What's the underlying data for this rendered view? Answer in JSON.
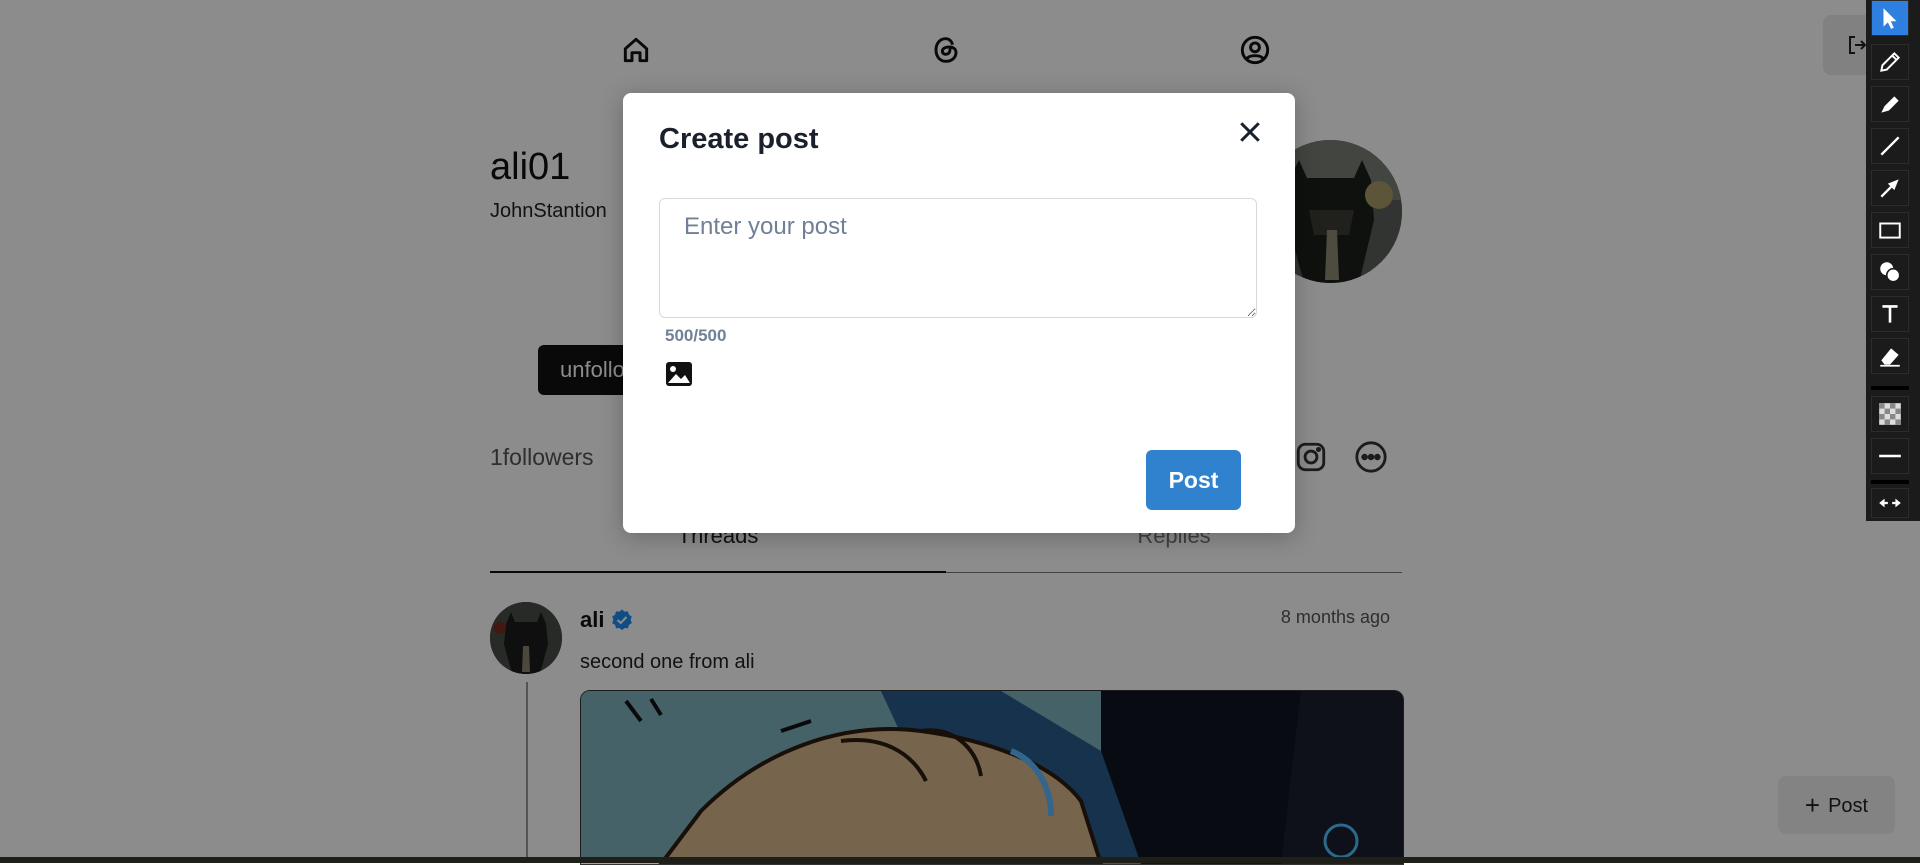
{
  "nav": {
    "icons": [
      "home-icon",
      "threads-logo-icon",
      "user-icon"
    ],
    "logout_icon": "logout-icon"
  },
  "profile": {
    "username": "ali01",
    "full_name": "JohnStantion",
    "unfollow_label": "unfollow",
    "followers": "1followers",
    "social_icons": [
      "instagram-icon",
      "more-icon"
    ]
  },
  "tabs": [
    {
      "label": "Threads",
      "active": true
    },
    {
      "label": "Replies",
      "active": false
    }
  ],
  "post": {
    "author": "ali",
    "verified_icon": "verified-icon",
    "time": "8 months ago",
    "text": "second one from ali"
  },
  "floating_post": {
    "label": "Post",
    "icon": "plus-icon"
  },
  "modal": {
    "title": "Create post",
    "close_icon": "close-icon",
    "placeholder": "Enter your post",
    "char_count": "500/500",
    "image_icon": "image-icon",
    "submit_label": "Post"
  },
  "toolbar": {
    "tools": [
      "pointer-icon",
      "pen-icon",
      "highlighter-icon",
      "line-icon",
      "arrow-icon",
      "rectangle-icon",
      "counter-icon",
      "text-icon",
      "eraser-icon",
      "opacity-icon",
      "stroke-width-icon",
      "swap-icon"
    ],
    "active_tool": "pointer-icon"
  },
  "colors": {
    "accent": "#3182ce",
    "overlay": "rgba(0,0,0,0.45)",
    "toolbar_active": "#2f7fe0"
  }
}
